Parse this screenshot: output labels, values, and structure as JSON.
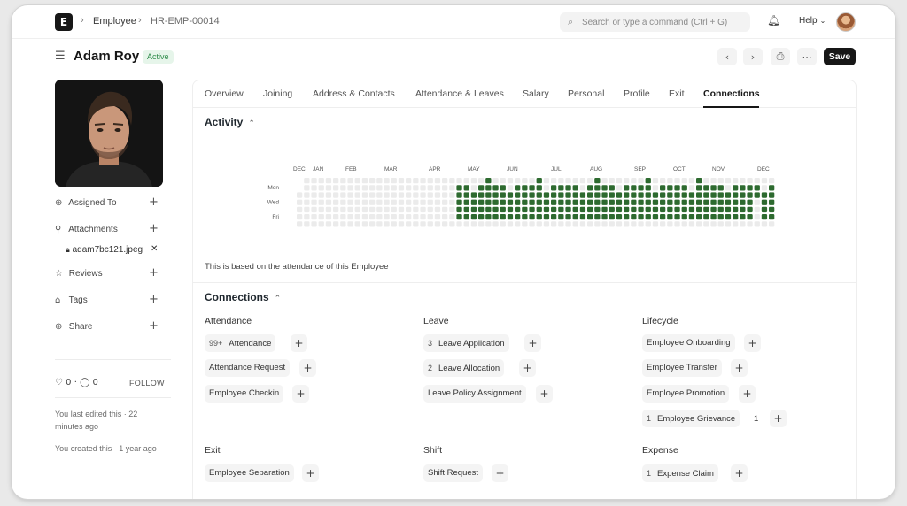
{
  "navbar": {
    "logo_letter": "E",
    "breadcrumbs": [
      "Employee",
      "HR-EMP-00014"
    ],
    "search_placeholder": "Search or type a command (Ctrl + G)",
    "help_label": "Help"
  },
  "doc": {
    "title": "Adam Roy",
    "status": "Active",
    "save_label": "Save"
  },
  "sidebar": {
    "assigned_to": "Assigned To",
    "attachments": "Attachments",
    "attachment_file": "adam7bc121.jpeg",
    "reviews": "Reviews",
    "tags": "Tags",
    "share": "Share",
    "likes": "0",
    "comments": "0",
    "follow": "FOLLOW",
    "edited_note": "You last edited this · 22 minutes ago",
    "created_note": "You created this · 1 year ago"
  },
  "tabs": [
    {
      "label": "Overview"
    },
    {
      "label": "Joining"
    },
    {
      "label": "Address & Contacts"
    },
    {
      "label": "Attendance & Leaves"
    },
    {
      "label": "Salary"
    },
    {
      "label": "Personal"
    },
    {
      "label": "Profile"
    },
    {
      "label": "Exit"
    },
    {
      "label": "Connections",
      "active": true
    }
  ],
  "activity": {
    "title": "Activity",
    "months": [
      "DEC",
      "JAN",
      "FEB",
      "MAR",
      "APR",
      "MAY",
      "JUN",
      "JUL",
      "AUG",
      "SEP",
      "OCT",
      "NOV",
      "DEC"
    ],
    "days": [
      "Mon",
      "Wed",
      "Fri"
    ],
    "note": "This is based on the attendance of this Employee",
    "colors": {
      "filled": "#2d6a2f",
      "empty": "#ebebeb"
    }
  },
  "connections": {
    "title": "Connections",
    "groups": [
      {
        "title": "Attendance",
        "items": [
          {
            "count": "99+",
            "label": "Attendance"
          },
          {
            "label": "Attendance Request"
          },
          {
            "label": "Employee Checkin"
          }
        ]
      },
      {
        "title": "Leave",
        "items": [
          {
            "count": "3",
            "label": "Leave Application"
          },
          {
            "count": "2",
            "label": "Leave Allocation"
          },
          {
            "label": "Leave Policy Assignment"
          }
        ]
      },
      {
        "title": "Lifecycle",
        "items": [
          {
            "label": "Employee Onboarding"
          },
          {
            "label": "Employee Transfer"
          },
          {
            "label": "Employee Promotion"
          },
          {
            "count": "1",
            "label": "Employee Grievance",
            "extra": "1"
          }
        ]
      },
      {
        "title": "Exit",
        "items": [
          {
            "label": "Employee Separation"
          }
        ]
      },
      {
        "title": "Shift",
        "items": [
          {
            "label": "Shift Request"
          }
        ]
      },
      {
        "title": "Expense",
        "items": [
          {
            "count": "1",
            "label": "Expense Claim"
          }
        ]
      }
    ]
  }
}
